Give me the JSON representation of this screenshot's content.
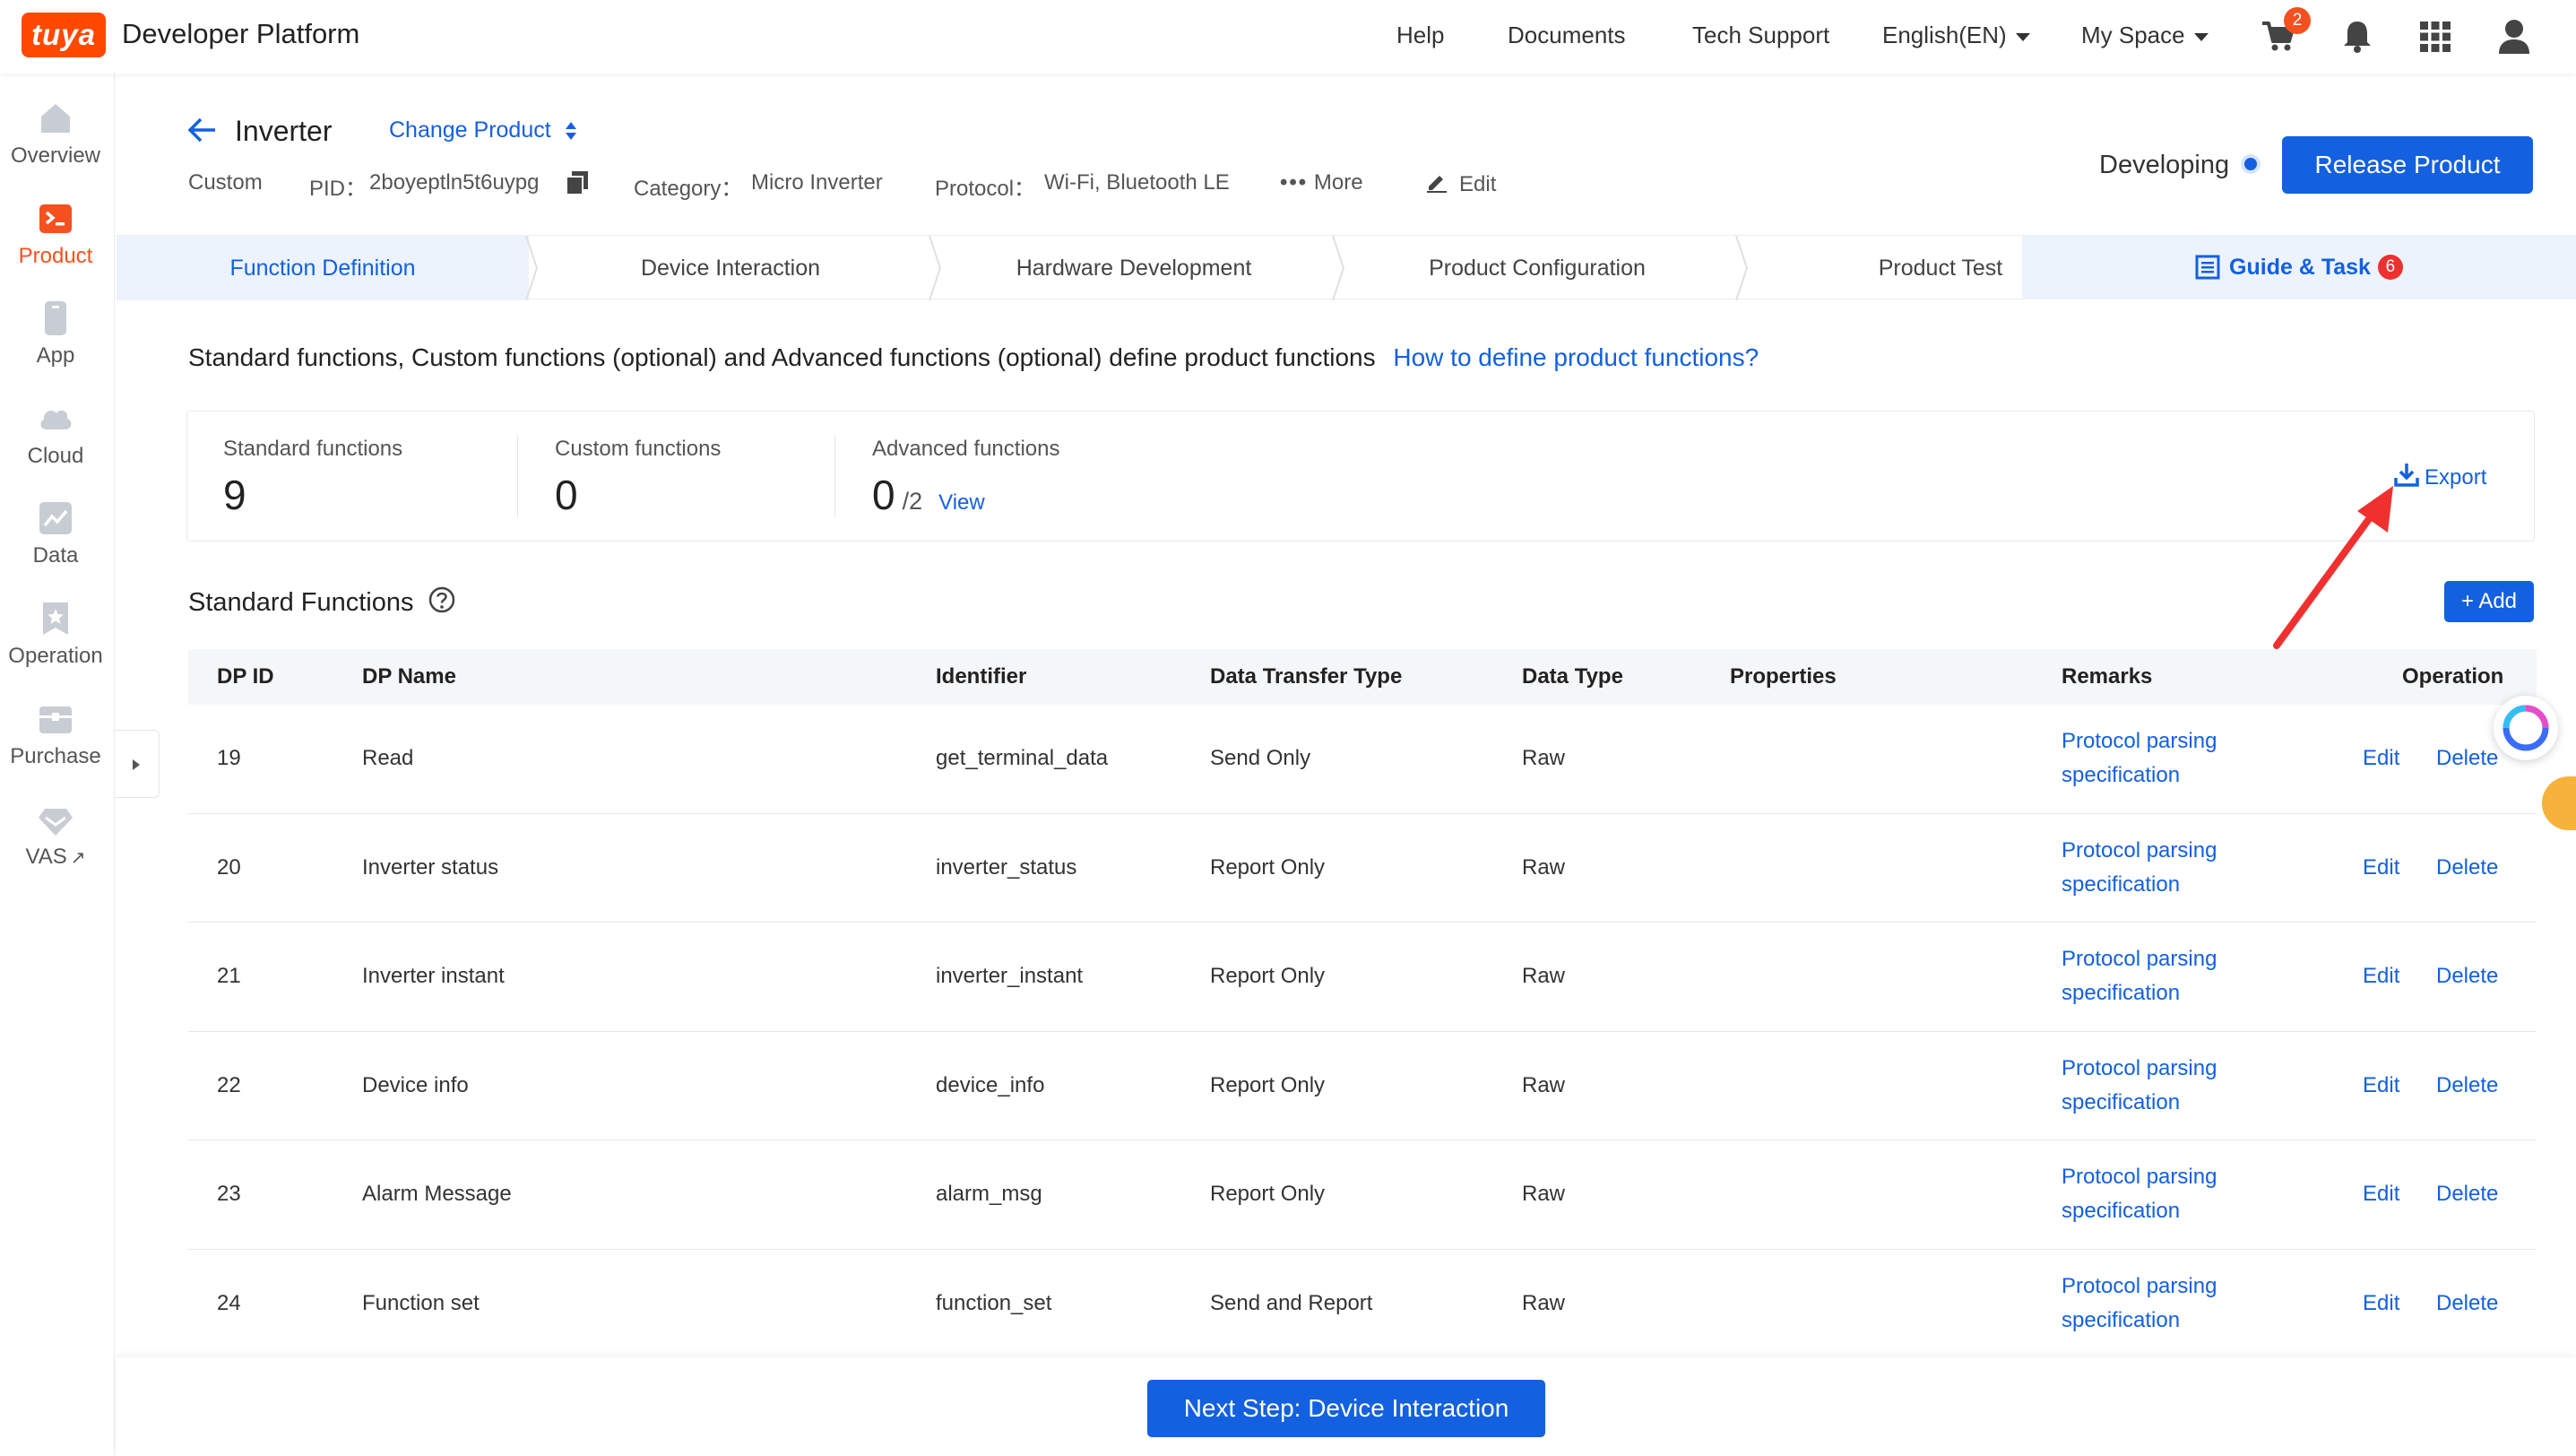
{
  "topbar": {
    "logo_text": "tuya",
    "platform_title": "Developer Platform",
    "nav": [
      "Help",
      "Documents",
      "Tech Support"
    ],
    "language": "English(EN)",
    "space": "My Space",
    "cart_count": "2",
    "icons": [
      "cart-icon",
      "bell-icon",
      "apps-grid-icon",
      "user-icon"
    ]
  },
  "sidebar": {
    "items": [
      {
        "label": "Overview",
        "icon": "home-icon"
      },
      {
        "label": "Product",
        "icon": "terminal-icon"
      },
      {
        "label": "App",
        "icon": "phone-icon"
      },
      {
        "label": "Cloud",
        "icon": "cloud-icon"
      },
      {
        "label": "Data",
        "icon": "chart-icon"
      },
      {
        "label": "Operation",
        "icon": "bookmark-star-icon"
      },
      {
        "label": "Purchase",
        "icon": "box-icon"
      },
      {
        "label": "VAS",
        "icon": "diamond-icon"
      }
    ],
    "active": "Product",
    "active_color": "#f5501f"
  },
  "header": {
    "product_name": "Inverter",
    "change_product": "Change Product",
    "custom": "Custom",
    "pid_label": "PID：",
    "pid": "2boyeptln5t6uypg",
    "category_label": "Category：",
    "category": "Micro Inverter",
    "protocol_label": "Protocol：",
    "protocol": "Wi-Fi, Bluetooth LE",
    "more": "More",
    "edit": "Edit",
    "status": "Developing",
    "release_button": "Release Product"
  },
  "steps": {
    "items": [
      "Function Definition",
      "Device Interaction",
      "Hardware Development",
      "Product Configuration",
      "Product Test"
    ],
    "active": "Function Definition",
    "guide": "Guide & Task",
    "guide_count": "6"
  },
  "intro": {
    "text": "Standard functions, Custom functions (optional) and Advanced functions (optional) define product functions",
    "link": "How to define product functions?"
  },
  "stats": {
    "standard_label": "Standard functions",
    "standard_value": "9",
    "custom_label": "Custom functions",
    "custom_value": "0",
    "advanced_label": "Advanced functions",
    "advanced_value": "0",
    "advanced_total": "/2",
    "view_link": "View",
    "export": "Export"
  },
  "section": {
    "title": "Standard Functions",
    "add_button": "+ Add"
  },
  "table": {
    "columns": [
      "DP ID",
      "DP Name",
      "Identifier",
      "Data Transfer Type",
      "Data Type",
      "Properties",
      "Remarks",
      "Operation"
    ],
    "rows": [
      {
        "id": "19",
        "name": "Read",
        "identifier": "get_terminal_data",
        "transfer": "Send Only",
        "type": "Raw",
        "properties": "",
        "remark1": "Protocol parsing",
        "remark2": "specification",
        "edit": "Edit",
        "delete": "Delete"
      },
      {
        "id": "20",
        "name": "Inverter status",
        "identifier": "inverter_status",
        "transfer": "Report Only",
        "type": "Raw",
        "properties": "",
        "remark1": "Protocol parsing",
        "remark2": "specification",
        "edit": "Edit",
        "delete": "Delete"
      },
      {
        "id": "21",
        "name": "Inverter instant",
        "identifier": "inverter_instant",
        "transfer": "Report Only",
        "type": "Raw",
        "properties": "",
        "remark1": "Protocol parsing",
        "remark2": "specification",
        "edit": "Edit",
        "delete": "Delete"
      },
      {
        "id": "22",
        "name": "Device info",
        "identifier": "device_info",
        "transfer": "Report Only",
        "type": "Raw",
        "properties": "",
        "remark1": "Protocol parsing",
        "remark2": "specification",
        "edit": "Edit",
        "delete": "Delete"
      },
      {
        "id": "23",
        "name": "Alarm Message",
        "identifier": "alarm_msg",
        "transfer": "Report Only",
        "type": "Raw",
        "properties": "",
        "remark1": "Protocol parsing",
        "remark2": "specification",
        "edit": "Edit",
        "delete": "Delete"
      },
      {
        "id": "24",
        "name": "Function set",
        "identifier": "function_set",
        "transfer": "Send and Report",
        "type": "Raw",
        "properties": "",
        "remark1": "Protocol parsing",
        "remark2": "specification",
        "edit": "Edit",
        "delete": "Delete"
      }
    ]
  },
  "footer": {
    "next_button": "Next Step: Device Interaction"
  },
  "colors": {
    "primary": "#1360e0",
    "brand": "#ff4800",
    "annotation_arrow": "#f0302f"
  }
}
